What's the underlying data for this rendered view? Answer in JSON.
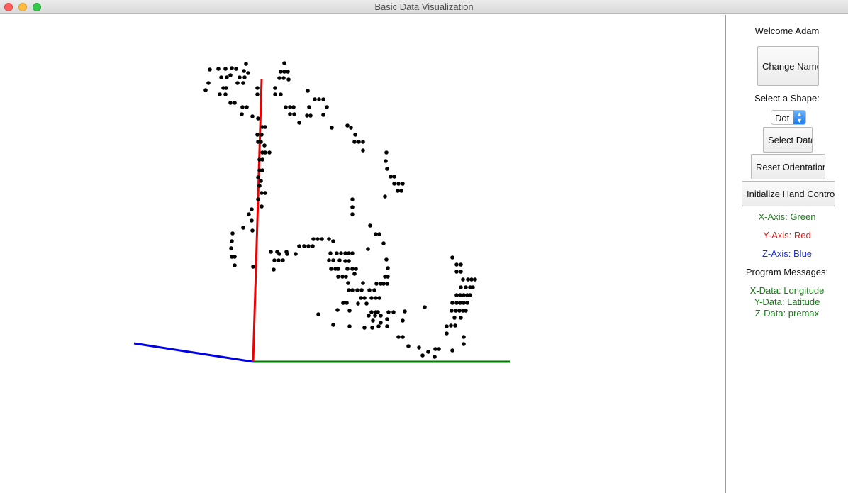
{
  "window": {
    "title": "Basic Data Visualization"
  },
  "panel": {
    "welcome": "Welcome Adam",
    "change_name": "Change Name",
    "select_shape_label": "Select a Shape:",
    "shape_value": "Dot",
    "select_data": "Select Data",
    "reset_orientation": "Reset Orientation",
    "init_hand_control": "Initialize Hand Control",
    "x_axis": "X-Axis: Green",
    "y_axis": "Y-Axis: Red",
    "z_axis": "Z-Axis: Blue",
    "program_messages": "Program Messages:",
    "x_data": "X-Data: Longitude",
    "y_data": "Y-Data: Latitude",
    "z_data": "Z-Data: premax"
  },
  "colors": {
    "x_axis": "#007a00",
    "y_axis": "#ee0000",
    "z_axis": "#0000e6",
    "point": "#000000"
  },
  "chart_data": {
    "type": "scatter",
    "title": "",
    "xlabel": "",
    "ylabel": "",
    "points": [
      [
        296,
        98
      ],
      [
        308,
        97
      ],
      [
        318,
        97
      ],
      [
        327,
        96
      ],
      [
        333,
        97
      ],
      [
        347,
        90
      ],
      [
        344,
        100
      ],
      [
        350,
        103
      ],
      [
        325,
        106
      ],
      [
        312,
        109
      ],
      [
        320,
        109
      ],
      [
        338,
        109
      ],
      [
        345,
        109
      ],
      [
        294,
        117
      ],
      [
        315,
        124
      ],
      [
        319,
        124
      ],
      [
        335,
        117
      ],
      [
        343,
        117
      ],
      [
        290,
        127
      ],
      [
        310,
        133
      ],
      [
        318,
        133
      ],
      [
        325,
        145
      ],
      [
        331,
        145
      ],
      [
        342,
        151
      ],
      [
        348,
        151
      ],
      [
        341,
        161
      ],
      [
        356,
        164
      ],
      [
        363,
        124
      ],
      [
        363,
        133
      ],
      [
        364,
        167
      ],
      [
        370,
        179
      ],
      [
        374,
        179
      ],
      [
        363,
        190
      ],
      [
        369,
        190
      ],
      [
        364,
        200
      ],
      [
        368,
        200
      ],
      [
        373,
        205
      ],
      [
        370,
        215
      ],
      [
        374,
        215
      ],
      [
        380,
        215
      ],
      [
        366,
        225
      ],
      [
        370,
        225
      ],
      [
        366,
        240
      ],
      [
        370,
        240
      ],
      [
        364,
        250
      ],
      [
        368,
        255
      ],
      [
        366,
        262
      ],
      [
        369,
        272
      ],
      [
        374,
        272
      ],
      [
        364,
        281
      ],
      [
        369,
        291
      ],
      [
        355,
        295
      ],
      [
        351,
        302
      ],
      [
        355,
        311
      ],
      [
        343,
        321
      ],
      [
        356,
        325
      ],
      [
        328,
        329
      ],
      [
        327,
        340
      ],
      [
        326,
        350
      ],
      [
        327,
        362
      ],
      [
        331,
        362
      ],
      [
        331,
        374
      ],
      [
        357,
        376
      ],
      [
        401,
        89
      ],
      [
        396,
        101
      ],
      [
        401,
        101
      ],
      [
        406,
        101
      ],
      [
        394,
        110
      ],
      [
        400,
        110
      ],
      [
        407,
        112
      ],
      [
        388,
        124
      ],
      [
        388,
        133
      ],
      [
        396,
        133
      ],
      [
        434,
        128
      ],
      [
        403,
        151
      ],
      [
        409,
        151
      ],
      [
        414,
        151
      ],
      [
        415,
        161
      ],
      [
        409,
        161
      ],
      [
        422,
        173
      ],
      [
        436,
        151
      ],
      [
        433,
        163
      ],
      [
        438,
        163
      ],
      [
        444,
        140
      ],
      [
        450,
        140
      ],
      [
        456,
        140
      ],
      [
        461,
        151
      ],
      [
        456,
        162
      ],
      [
        468,
        180
      ],
      [
        490,
        177
      ],
      [
        495,
        180
      ],
      [
        501,
        190
      ],
      [
        500,
        200
      ],
      [
        506,
        200
      ],
      [
        512,
        200
      ],
      [
        512,
        212
      ],
      [
        545,
        215
      ],
      [
        544,
        227
      ],
      [
        546,
        238
      ],
      [
        551,
        249
      ],
      [
        556,
        249
      ],
      [
        556,
        259
      ],
      [
        562,
        259
      ],
      [
        568,
        259
      ],
      [
        561,
        269
      ],
      [
        566,
        269
      ],
      [
        543,
        277
      ],
      [
        497,
        281
      ],
      [
        497,
        292
      ],
      [
        497,
        302
      ],
      [
        522,
        318
      ],
      [
        530,
        330
      ],
      [
        535,
        330
      ],
      [
        541,
        343
      ],
      [
        519,
        351
      ],
      [
        545,
        366
      ],
      [
        547,
        378
      ],
      [
        543,
        390
      ],
      [
        547,
        390
      ],
      [
        531,
        400
      ],
      [
        537,
        400
      ],
      [
        541,
        400
      ],
      [
        546,
        400
      ],
      [
        382,
        355
      ],
      [
        391,
        355
      ],
      [
        404,
        355
      ],
      [
        394,
        358
      ],
      [
        405,
        358
      ],
      [
        387,
        367
      ],
      [
        393,
        367
      ],
      [
        399,
        367
      ],
      [
        386,
        380
      ],
      [
        417,
        358
      ],
      [
        422,
        347
      ],
      [
        429,
        347
      ],
      [
        435,
        347
      ],
      [
        441,
        347
      ],
      [
        442,
        337
      ],
      [
        448,
        337
      ],
      [
        454,
        337
      ],
      [
        464,
        337
      ],
      [
        470,
        340
      ],
      [
        466,
        357
      ],
      [
        475,
        357
      ],
      [
        481,
        357
      ],
      [
        487,
        357
      ],
      [
        492,
        357
      ],
      [
        497,
        357
      ],
      [
        464,
        367
      ],
      [
        470,
        367
      ],
      [
        479,
        367
      ],
      [
        487,
        368
      ],
      [
        492,
        368
      ],
      [
        467,
        379
      ],
      [
        473,
        379
      ],
      [
        477,
        379
      ],
      [
        490,
        379
      ],
      [
        497,
        379
      ],
      [
        502,
        379
      ],
      [
        477,
        390
      ],
      [
        483,
        390
      ],
      [
        488,
        390
      ],
      [
        500,
        386
      ],
      [
        491,
        399
      ],
      [
        492,
        409
      ],
      [
        497,
        409
      ],
      [
        504,
        409
      ],
      [
        510,
        409
      ],
      [
        512,
        399
      ],
      [
        521,
        409
      ],
      [
        528,
        409
      ],
      [
        509,
        420
      ],
      [
        514,
        420
      ],
      [
        524,
        420
      ],
      [
        530,
        420
      ],
      [
        535,
        420
      ],
      [
        484,
        427
      ],
      [
        489,
        427
      ],
      [
        517,
        428
      ],
      [
        476,
        437
      ],
      [
        493,
        438
      ],
      [
        505,
        428
      ],
      [
        524,
        440
      ],
      [
        530,
        440
      ],
      [
        533,
        440
      ],
      [
        548,
        440
      ],
      [
        555,
        440
      ],
      [
        520,
        445
      ],
      [
        529,
        445
      ],
      [
        537,
        445
      ],
      [
        526,
        452
      ],
      [
        537,
        455
      ],
      [
        546,
        450
      ],
      [
        546,
        460
      ],
      [
        571,
        439
      ],
      [
        568,
        452
      ],
      [
        599,
        433
      ],
      [
        449,
        443
      ],
      [
        470,
        458
      ],
      [
        493,
        460
      ],
      [
        514,
        462
      ],
      [
        525,
        462
      ],
      [
        534,
        460
      ],
      [
        562,
        475
      ],
      [
        568,
        475
      ],
      [
        576,
        488
      ],
      [
        591,
        490
      ],
      [
        596,
        501
      ],
      [
        604,
        496
      ],
      [
        613,
        503
      ],
      [
        614,
        492
      ],
      [
        619,
        492
      ],
      [
        638,
        494
      ],
      [
        638,
        363
      ],
      [
        644,
        373
      ],
      [
        650,
        373
      ],
      [
        644,
        383
      ],
      [
        650,
        383
      ],
      [
        653,
        394
      ],
      [
        660,
        394
      ],
      [
        665,
        394
      ],
      [
        670,
        394
      ],
      [
        650,
        405
      ],
      [
        657,
        405
      ],
      [
        663,
        405
      ],
      [
        667,
        405
      ],
      [
        644,
        416
      ],
      [
        649,
        416
      ],
      [
        654,
        416
      ],
      [
        659,
        416
      ],
      [
        663,
        416
      ],
      [
        638,
        427
      ],
      [
        644,
        427
      ],
      [
        649,
        427
      ],
      [
        654,
        427
      ],
      [
        659,
        427
      ],
      [
        637,
        438
      ],
      [
        643,
        438
      ],
      [
        648,
        438
      ],
      [
        653,
        438
      ],
      [
        657,
        438
      ],
      [
        641,
        448
      ],
      [
        650,
        448
      ],
      [
        636,
        459
      ],
      [
        642,
        459
      ],
      [
        630,
        460
      ],
      [
        630,
        470
      ],
      [
        654,
        475
      ],
      [
        654,
        485
      ]
    ]
  }
}
